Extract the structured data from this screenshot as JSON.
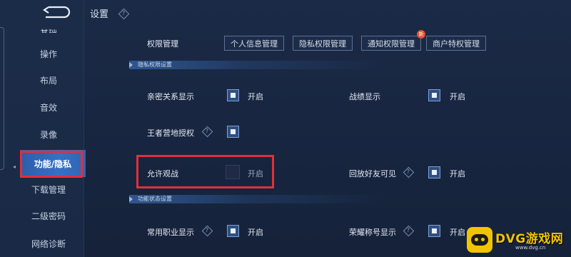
{
  "header": {
    "title": "设置",
    "help_icon": "diamond-question-icon",
    "back_icon": "back-arrow-icon"
  },
  "sidebar": {
    "items": [
      {
        "label": "基础",
        "partial": true
      },
      {
        "label": "操作"
      },
      {
        "label": "布局"
      },
      {
        "label": "音效"
      },
      {
        "label": "录像"
      },
      {
        "label": "功能/隐私",
        "active": true
      },
      {
        "label": "下载管理"
      },
      {
        "label": "二级密码"
      },
      {
        "label": "网络诊断"
      }
    ]
  },
  "permissions": {
    "label": "权限管理",
    "tabs": [
      {
        "label": "个人信息管理"
      },
      {
        "label": "隐私权限管理"
      },
      {
        "label": "通知权限管理",
        "badge": "新"
      },
      {
        "label": "商户特权管理"
      }
    ]
  },
  "privacy_section": {
    "title": "隐私权限设置",
    "settings": [
      {
        "label": "亲密关系显示",
        "checked": true,
        "state": "开启",
        "help": false
      },
      {
        "label": "战绩显示",
        "checked": true,
        "state": "开启",
        "help": false
      },
      {
        "label": "王者营地授权",
        "checked": true,
        "state": "",
        "help": true
      },
      {
        "label": "允许观战",
        "checked": false,
        "state": "开启",
        "help": false,
        "highlighted": true
      },
      {
        "label": "回放好友可见",
        "checked": true,
        "state": "开启",
        "help": true
      }
    ]
  },
  "function_section": {
    "title": "功能状态设置",
    "settings": [
      {
        "label": "常用职业显示",
        "checked": true,
        "state": "开启",
        "help": true
      },
      {
        "label": "荣耀称号显示",
        "checked": true,
        "state": "开启",
        "help": true
      }
    ]
  },
  "watermark": {
    "title": "DVG游戏网",
    "url": "www.dvg.cn"
  },
  "colors": {
    "background": "#182641",
    "active_tab": "#3571c7",
    "checkbox_on": "#2e4f82",
    "highlight_box": "#e0303a",
    "watermark": "#f1c400"
  }
}
